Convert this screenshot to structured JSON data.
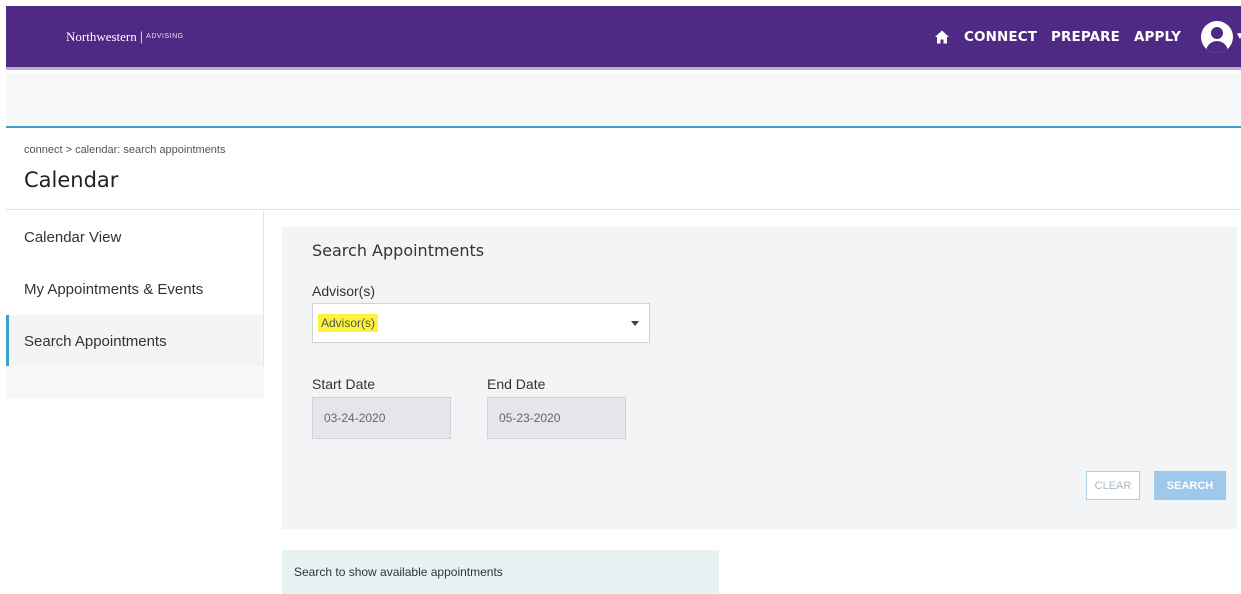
{
  "topbar": {
    "logo": {
      "name": "Northwestern",
      "separator": "|",
      "sub": "ADVISING"
    },
    "nav": [
      "CONNECT",
      "PREPARE",
      "APPLY"
    ],
    "home_icon": "home-icon",
    "avatar_icon": "user-avatar-icon",
    "bar_color": "#4e2a84"
  },
  "header": {
    "breadcrumb": "connect > calendar: search appointments",
    "title": "Calendar"
  },
  "sidebar": {
    "items": [
      {
        "label": "Calendar View",
        "active": false
      },
      {
        "label": "My Appointments & Events",
        "active": false
      },
      {
        "label": "Search Appointments",
        "active": true
      }
    ],
    "accent": "#3aa2c6"
  },
  "search": {
    "title": "Search Appointments",
    "advisor_label": "Advisor(s)",
    "advisor_placeholder": "Advisor(s)",
    "start_label": "Start Date",
    "start_value": "03-24-2020",
    "end_label": "End Date",
    "end_value": "05-23-2020",
    "clear_label": "CLEAR",
    "search_label": "SEARCH"
  },
  "notice": "Search to show available appointments"
}
